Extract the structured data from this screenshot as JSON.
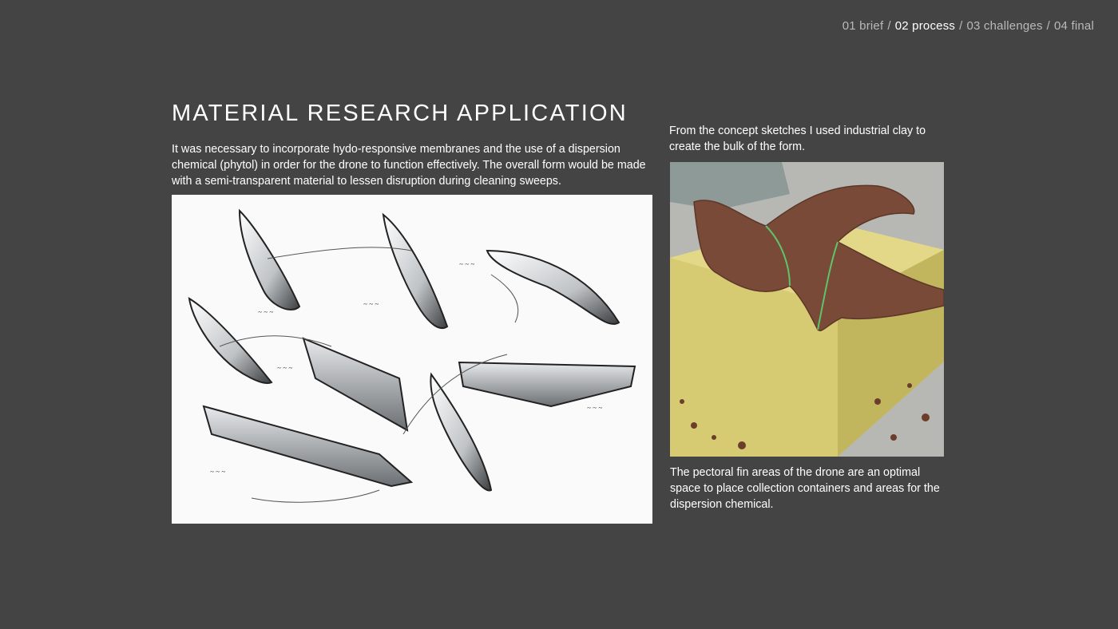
{
  "nav": {
    "items": [
      {
        "label": "01 brief",
        "active": false
      },
      {
        "label": "02 process",
        "active": true
      },
      {
        "label": "03 challenges",
        "active": false
      },
      {
        "label": "04 final",
        "active": false
      }
    ],
    "separator": "/"
  },
  "page": {
    "title": "MATERIAL RESEARCH APPLICATION",
    "intro": "It was necessary to incorporate hydo-responsive membranes and the use of a dispersion chemical (phytol) in order for the drone to function effectively. The overall form would be made with a semi-transparent material to lessen disruption during cleaning sweeps.",
    "caption_top": "From the concept sketches I used industrial clay to create the bulk of the form.",
    "caption_bottom": "The pectoral fin areas of the drone are an optimal space to place collection containers and areas for the dispersion chemical."
  },
  "colors": {
    "background": "#444444",
    "nav_inactive": "#b9b9b9",
    "nav_active": "#ffffff",
    "clay": "#7a4a38",
    "foam": "#d9cf7a"
  }
}
